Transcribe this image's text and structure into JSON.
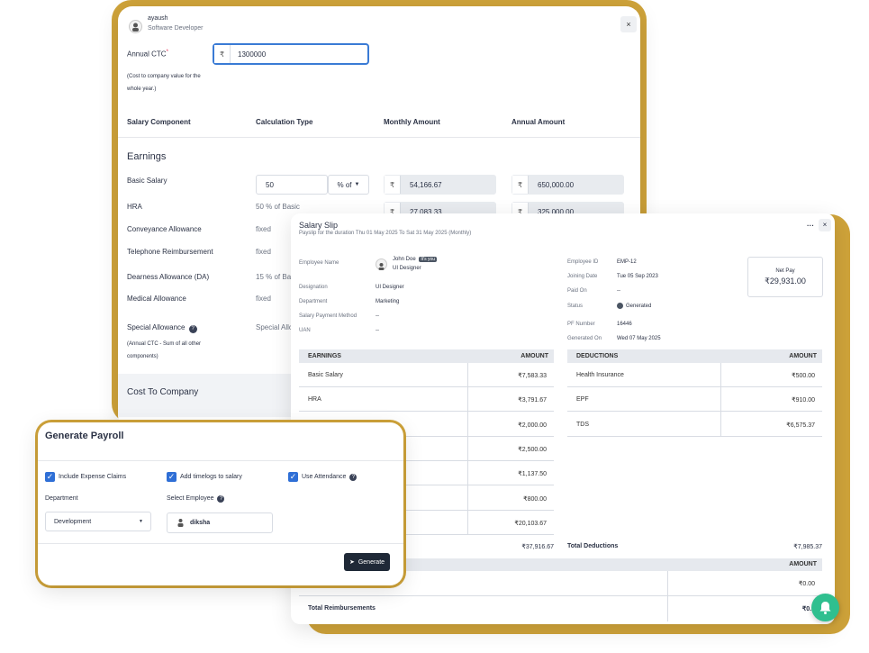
{
  "salary_panel": {
    "user_name": "ayaush",
    "user_role": "Software Developer",
    "close_icon": "close-icon",
    "ctc_label": "Annual CTC",
    "ctc_required": "*",
    "ctc_currency": "₹",
    "ctc_value": "1300000",
    "ctc_note": "(Cost to company value for the whole year.)",
    "columns": [
      "Salary Component",
      "Calculation Type",
      "Monthly Amount",
      "Annual Amount"
    ],
    "earnings_title": "Earnings",
    "basic": {
      "label": "Basic Salary",
      "value": "50",
      "unit": "% of",
      "monthly": "54,166.67",
      "annual": "650,000.00"
    },
    "hra": {
      "label": "HRA",
      "calc": "50 % of Basic",
      "monthly": "27,083.33",
      "annual": "325,000.00"
    },
    "rows": [
      {
        "label": "Conveyance Allowance",
        "calc": "fixed"
      },
      {
        "label": "Telephone Reimbursement",
        "calc": "fixed"
      },
      {
        "label": "Dearness Allowance (DA)",
        "calc": "15 % of Ba"
      },
      {
        "label": "Medical Allowance",
        "calc": "fixed"
      }
    ],
    "special": {
      "label": "Special Allowance",
      "calc": "Special Allo",
      "note": "(Annual CTC - Sum of all other components)"
    },
    "ctc_footer": "Cost To Company",
    "currency": "₹"
  },
  "salary_slip": {
    "title": "Salary Slip",
    "subtitle": "Payslip for the duration Thu 01 May 2025 To Sat 31 May 2025 (Monthly)",
    "more_icon": "more-icon",
    "close_icon": "close-icon",
    "left_fields": [
      {
        "label": "Employee Name",
        "value": ""
      },
      {
        "label": "Designation",
        "value": "UI Designer"
      },
      {
        "label": "Department",
        "value": "Marketing"
      },
      {
        "label": "Salary Payment Method",
        "value": "--"
      },
      {
        "label": "UAN",
        "value": "--"
      }
    ],
    "employee": {
      "name": "John Doe",
      "badge": "It's you",
      "role": "UI Designer"
    },
    "right_fields": [
      {
        "label": "Employee ID",
        "value": "EMP-12"
      },
      {
        "label": "Joining Date",
        "value": "Tue 05 Sep 2023"
      },
      {
        "label": "Paid On",
        "value": "--"
      },
      {
        "label": "Status",
        "value": "Generated"
      },
      {
        "label": "PF Number",
        "value": "16446"
      },
      {
        "label": "Generated On",
        "value": "Wed 07 May 2025"
      }
    ],
    "net_pay_label": "Net Pay",
    "net_pay_value": "₹29,931.00",
    "earnings_head": "EARNINGS",
    "amount_head": "AMOUNT",
    "earnings": [
      {
        "label": "Basic Salary",
        "amount": "₹7,583.33"
      },
      {
        "label": "HRA",
        "amount": "₹3,791.67"
      },
      {
        "label": "",
        "amount": "₹2,000.00"
      },
      {
        "label": "",
        "amount": "₹2,500.00"
      },
      {
        "label": "",
        "amount": "₹1,137.50"
      },
      {
        "label": "",
        "amount": "₹800.00"
      },
      {
        "label": "",
        "amount": "₹20,103.67"
      }
    ],
    "earnings_total": "₹37,916.67",
    "deductions_head": "DEDUCTIONS",
    "deductions": [
      {
        "label": "Health Insurance",
        "amount": "₹500.00"
      },
      {
        "label": "EPF",
        "amount": "₹910.00"
      },
      {
        "label": "TDS",
        "amount": "₹6,575.37"
      }
    ],
    "total_deductions_label": "Total Deductions",
    "total_deductions_value": "₹7,985.37",
    "reimb_amount_head": "AMOUNT",
    "reimb_value": "₹0.00",
    "total_reimb_label": "Total Reimbursements",
    "total_reimb_value": "₹0.0",
    "bell_icon": "bell-icon"
  },
  "payroll": {
    "title": "Generate Payroll",
    "checks": [
      {
        "label": "Include Expense Claims"
      },
      {
        "label": "Add timelogs to salary"
      },
      {
        "label": "Use Attendance"
      }
    ],
    "department_label": "Department",
    "department_value": "Development",
    "employee_label": "Select Employee",
    "employee_value": "diksha",
    "generate_label": "Generate"
  }
}
